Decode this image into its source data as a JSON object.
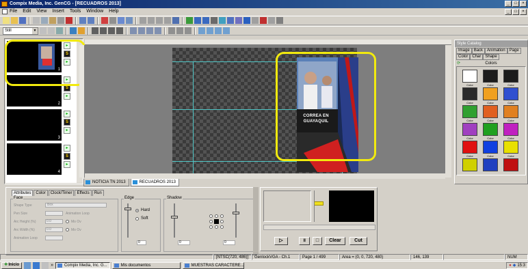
{
  "window": {
    "title": "Compix Media, Inc. GenCG - [RECUADROS 2013]",
    "controls": [
      "_",
      "□",
      "×"
    ],
    "doc_controls": [
      "_",
      "□",
      "×"
    ]
  },
  "menu": [
    "File",
    "Edit",
    "View",
    "Insert",
    "Tools",
    "Window",
    "Help"
  ],
  "toolbar2": {
    "zoom_value": "Still"
  },
  "thumbnails": [
    {
      "number": "1"
    },
    {
      "number": "2"
    },
    {
      "number": "3"
    },
    {
      "number": "4"
    }
  ],
  "canvas": {
    "graphic_caption_line1": "CORREA EN",
    "graphic_caption_line2": "GUAYAQUIL",
    "highlight_color": "#f2ea0e"
  },
  "doc_tabs": [
    "NOTICIA TN 2013",
    "RECUADROS 2013"
  ],
  "style_catalog": {
    "title": "Style Catalog",
    "tabs": [
      "Image",
      "Back",
      "Animation",
      "Page",
      "Color",
      "Char",
      "Shape"
    ],
    "section": "Colors",
    "swatch_label": "Color",
    "swatches": [
      "#ffffff",
      "#1c1c1c",
      "#1c1c1c",
      "#2a2a2a",
      "#f0a020",
      "#3050d0",
      "#30a030",
      "#e06020",
      "#e08020",
      "#a040c0",
      "#20a020",
      "#c020c0",
      "#e01010",
      "#1040e0",
      "#e8e000",
      "#d0d000",
      "#2040c0",
      "#c01010"
    ]
  },
  "attributes": {
    "tabs": [
      "Attributes",
      "Color",
      "Clock/Timer",
      "Effects",
      "Run"
    ],
    "face_label": "Face",
    "face_fields": [
      {
        "label": "Shape Type",
        "value": "Box"
      },
      {
        "label": "Pen Size",
        "value": ""
      },
      {
        "label": "Arc Height (%)",
        "value": "0.0"
      },
      {
        "label": "Arc Width (%)",
        "value": "0.0"
      },
      {
        "label": "Animation Loop",
        "value": ""
      }
    ],
    "animation_loop_label": "Animation Loop",
    "mo_chk": "Mo Ov",
    "mo_chk2": "Mo Ov",
    "edge_label": "Edge",
    "edge_hard": "Hard",
    "edge_soft": "Soft",
    "edge_value": "0",
    "shadow_label": "Shadow",
    "shadow_value1": "0",
    "shadow_value2": "0"
  },
  "preview": {
    "clear_label": "Clear",
    "cut_label": "Cut"
  },
  "statusbar": [
    "",
    "[NTSC(720, 486)]",
    "GenlockVGA - Ch.1",
    "Page 1 / 499",
    "Area = (0, 0, 720, 480)",
    "146, 139",
    "",
    "NUM"
  ],
  "taskbar": {
    "start": "Inicio",
    "items": [
      "Compix Media, Inc. G...",
      "Mis documentos",
      "MUESTRAS CARACTERE..."
    ],
    "clock": "15:3"
  }
}
